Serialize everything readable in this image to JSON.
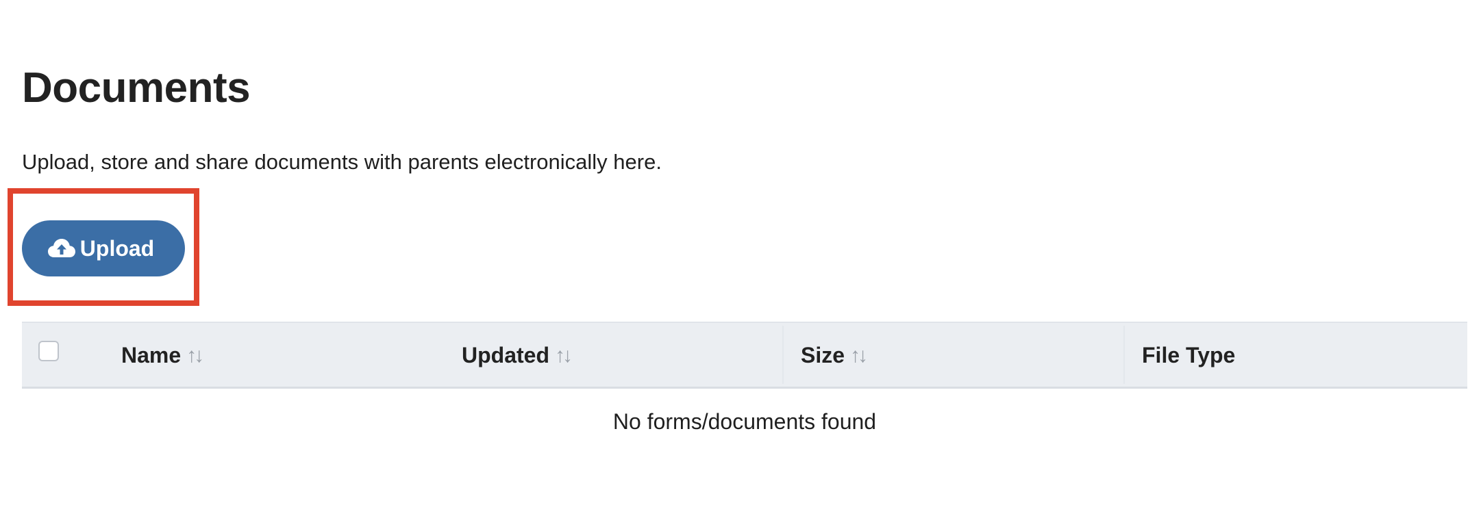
{
  "page": {
    "title": "Documents",
    "description": "Upload, store and share documents with parents electronically here."
  },
  "toolbar": {
    "upload_label": "Upload",
    "upload_icon": "cloud-upload-icon",
    "highlight_color": "#e0442e",
    "button_color": "#3b6ea6"
  },
  "table": {
    "columns": [
      {
        "label": "Name",
        "sortable": true
      },
      {
        "label": "Updated",
        "sortable": true
      },
      {
        "label": "Size",
        "sortable": true
      },
      {
        "label": "File Type",
        "sortable": false
      }
    ],
    "sort_icon": "sort-arrows-icon",
    "sort_glyph": "↑↓",
    "empty_message": "No forms/documents found",
    "header_bg": "#ebeef2"
  }
}
